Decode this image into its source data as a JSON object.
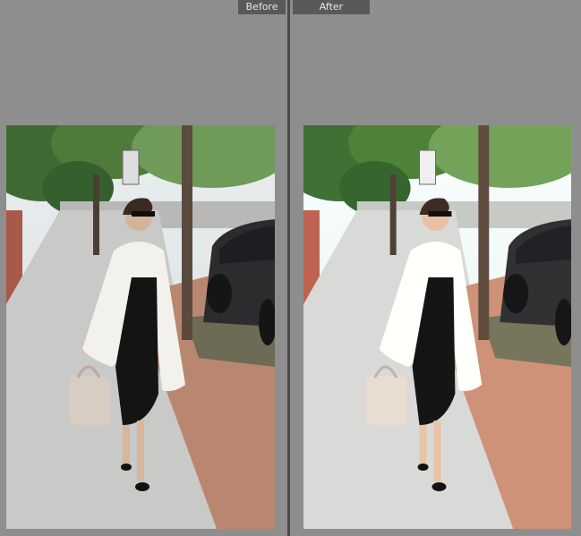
{
  "view": {
    "before_label": "Before",
    "after_label": "After"
  },
  "photo": {
    "subject": "street-fashion-photo",
    "colors": {
      "sidewalk": "#c9c9c7",
      "brick": "#b9876f",
      "foliage": "#3f6a34",
      "coat": "#f3f1ec",
      "dress": "#141414",
      "car": "#2c2c2e",
      "bag": "#d8cdc2"
    }
  }
}
